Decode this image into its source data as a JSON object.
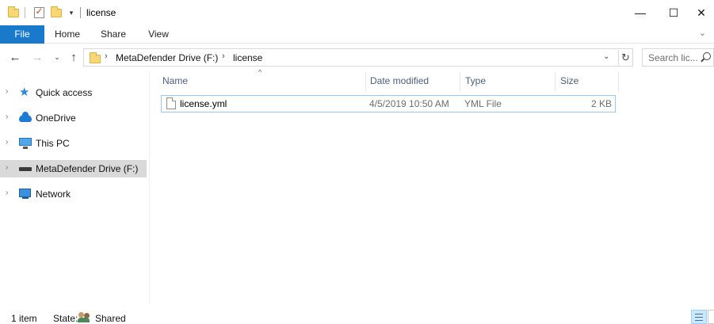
{
  "window": {
    "title": "license",
    "minimize_glyph": "—",
    "maximize_glyph": "☐",
    "close_glyph": "✕"
  },
  "ribbon": {
    "tabs": [
      "File",
      "Home",
      "Share",
      "View"
    ]
  },
  "address": {
    "crumbs": [
      "MetaDefender Drive (F:)",
      "license"
    ],
    "separator": "›"
  },
  "search": {
    "placeholder": "Search lic..."
  },
  "nav": {
    "items": [
      {
        "label": "Quick access",
        "icon": "quick-access-star-icon"
      },
      {
        "label": "OneDrive",
        "icon": "onedrive-cloud-icon"
      },
      {
        "label": "This PC",
        "icon": "this-pc-monitor-icon"
      },
      {
        "label": "MetaDefender Drive (F:)",
        "icon": "drive-icon",
        "selected": true
      },
      {
        "label": "Network",
        "icon": "network-icon"
      }
    ]
  },
  "filelist": {
    "columns": [
      "Name",
      "Date modified",
      "Type",
      "Size"
    ],
    "rows": [
      {
        "name": "license.yml",
        "date_modified": "4/5/2019 10:50 AM",
        "type": "YML File",
        "size": "2 KB"
      }
    ]
  },
  "status": {
    "item_count": "1 item",
    "state_label": "State:",
    "state_value": "Shared"
  },
  "colors": {
    "accent": "#1979ca",
    "selection_border": "#99c9ef",
    "nav_selected": "#d9d9d9"
  }
}
